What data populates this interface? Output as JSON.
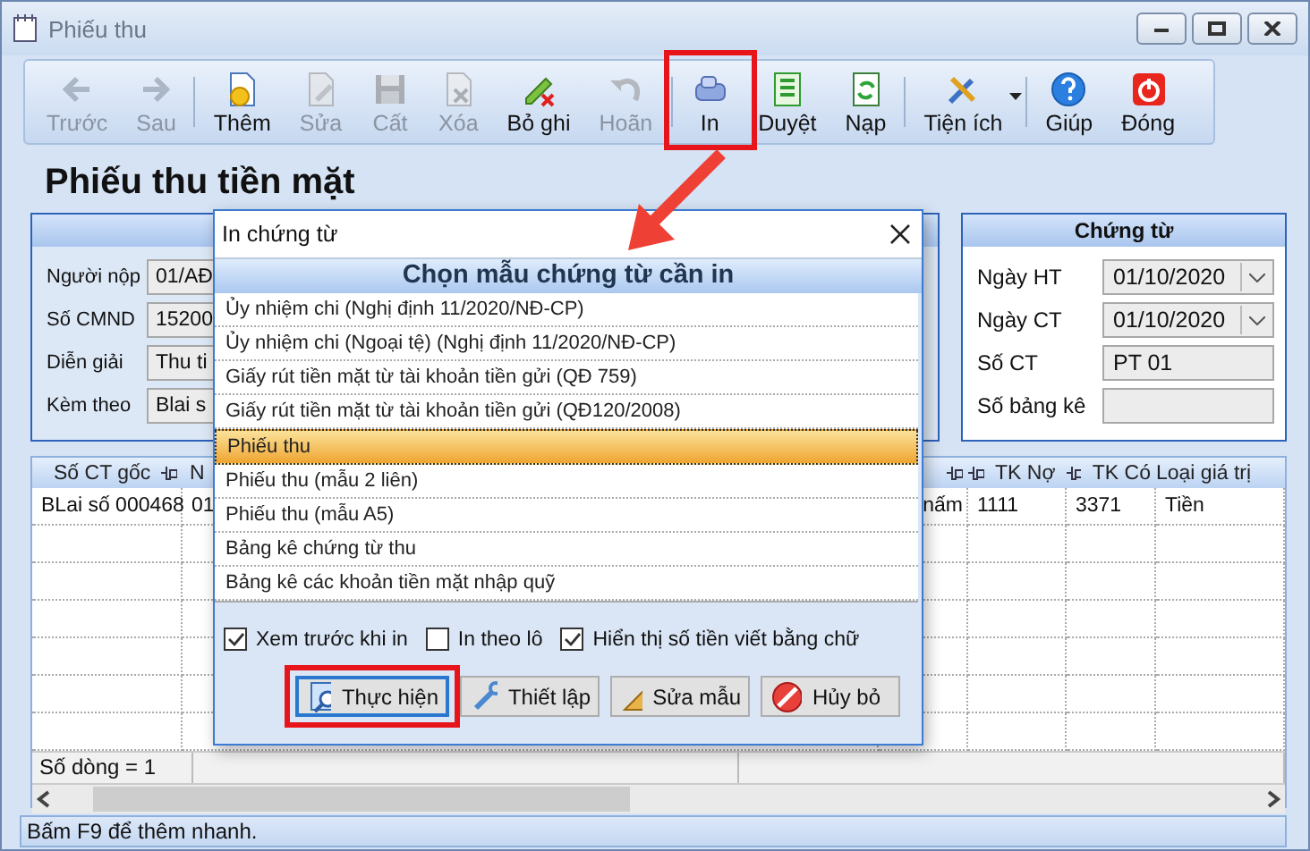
{
  "window": {
    "title": "Phiếu thu"
  },
  "toolbar": [
    {
      "label": "Trước",
      "kind": "button",
      "disabled": true,
      "highlighted": false
    },
    {
      "label": "Sau",
      "kind": "button",
      "disabled": true,
      "highlighted": false
    },
    {
      "label": "Thêm",
      "kind": "button",
      "disabled": false,
      "highlighted": false
    },
    {
      "label": "Sửa",
      "kind": "button",
      "disabled": true,
      "highlighted": false
    },
    {
      "label": "Cất",
      "kind": "button",
      "disabled": true,
      "highlighted": false
    },
    {
      "label": "Xóa",
      "kind": "button",
      "disabled": true,
      "highlighted": false
    },
    {
      "label": "Bỏ ghi",
      "kind": "button",
      "disabled": false,
      "highlighted": false
    },
    {
      "label": "Hoãn",
      "kind": "button",
      "disabled": true,
      "highlighted": false
    },
    {
      "label": "In",
      "kind": "button",
      "disabled": false,
      "highlighted": true
    },
    {
      "label": "Duyệt",
      "kind": "button",
      "disabled": false,
      "highlighted": false
    },
    {
      "label": "Nạp",
      "kind": "button",
      "disabled": false,
      "highlighted": false
    },
    {
      "label": "Tiện ích",
      "kind": "dropdown",
      "disabled": false,
      "highlighted": false
    },
    {
      "label": "Giúp",
      "kind": "button",
      "disabled": false,
      "highlighted": false
    },
    {
      "label": "Đóng",
      "kind": "button",
      "disabled": false,
      "highlighted": false
    }
  ],
  "heading": "Phiếu thu tiền mặt",
  "payer_panel": {
    "fields": [
      {
        "label": "Người nộp",
        "value": "01/AĐ"
      },
      {
        "label": "Số CMND",
        "value": "15200"
      },
      {
        "label": "Diễn giải",
        "value": "Thu ti"
      },
      {
        "label": "Kèm theo",
        "value": "Blai s"
      }
    ]
  },
  "voucher_panel": {
    "title": "Chứng từ",
    "fields": [
      {
        "label": "Ngày HT",
        "kind": "date",
        "value": "01/10/2020"
      },
      {
        "label": "Ngày CT",
        "kind": "date",
        "value": "01/10/2020"
      },
      {
        "label": "Số CT",
        "kind": "text",
        "value": "PT 01"
      },
      {
        "label": "Số bảng kê",
        "kind": "text"
      }
    ]
  },
  "grid": {
    "columns": [
      {
        "label": "Số CT gốc",
        "pinned": true
      },
      {
        "label": "N",
        "pinned": false
      },
      {
        "pinned": true
      },
      {
        "label": "TK Nợ",
        "pinned": true
      },
      {
        "label": "TK Có",
        "pinned": true
      },
      {
        "label": "Loại giá trị",
        "pinned": false
      }
    ],
    "rows": [
      [
        "BLai số 000468",
        "01",
        "nấm",
        "1111",
        "3371",
        "Tiền"
      ]
    ],
    "footer": "Số dòng = 1"
  },
  "status_bar": "Bấm F9 để thêm nhanh.",
  "dialog": {
    "title": "In chứng từ",
    "heading": "Chọn mẫu chứng từ cần in",
    "templates": [
      {
        "label": "Ủy nhiệm chi (Nghị định 11/2020/NĐ-CP)",
        "selected": false
      },
      {
        "label": "Ủy nhiệm chi (Ngoại tệ) (Nghị định 11/2020/NĐ-CP)",
        "selected": false
      },
      {
        "label": "Giấy rút tiền mặt từ tài khoản tiền gửi (QĐ 759)",
        "selected": false
      },
      {
        "label": "Giấy rút tiền mặt từ tài khoản tiền gửi (QĐ120/2008)",
        "selected": false
      },
      {
        "label": "Phiếu thu",
        "selected": true
      },
      {
        "label": "Phiếu thu (mẫu 2 liên)",
        "selected": false
      },
      {
        "label": "Phiếu thu (mẫu A5)",
        "selected": false
      },
      {
        "label": "Bảng kê chứng từ thu",
        "selected": false
      },
      {
        "label": "Bảng kê các khoản tiền mặt nhập quỹ",
        "selected": false
      }
    ],
    "options": [
      {
        "label": "Xem trước khi in",
        "checked": true
      },
      {
        "label": "In theo lô",
        "checked": false
      },
      {
        "label": "Hiển thị số tiền viết bằng chữ",
        "checked": true
      }
    ],
    "buttons": [
      {
        "label": "Thực hiện",
        "focused": true,
        "highlighted": true
      },
      {
        "label": "Thiết lập",
        "focused": false,
        "highlighted": false
      },
      {
        "label": "Sửa mẫu",
        "focused": false,
        "highlighted": false
      },
      {
        "label": "Hủy bỏ",
        "focused": false,
        "highlighted": false
      }
    ]
  }
}
